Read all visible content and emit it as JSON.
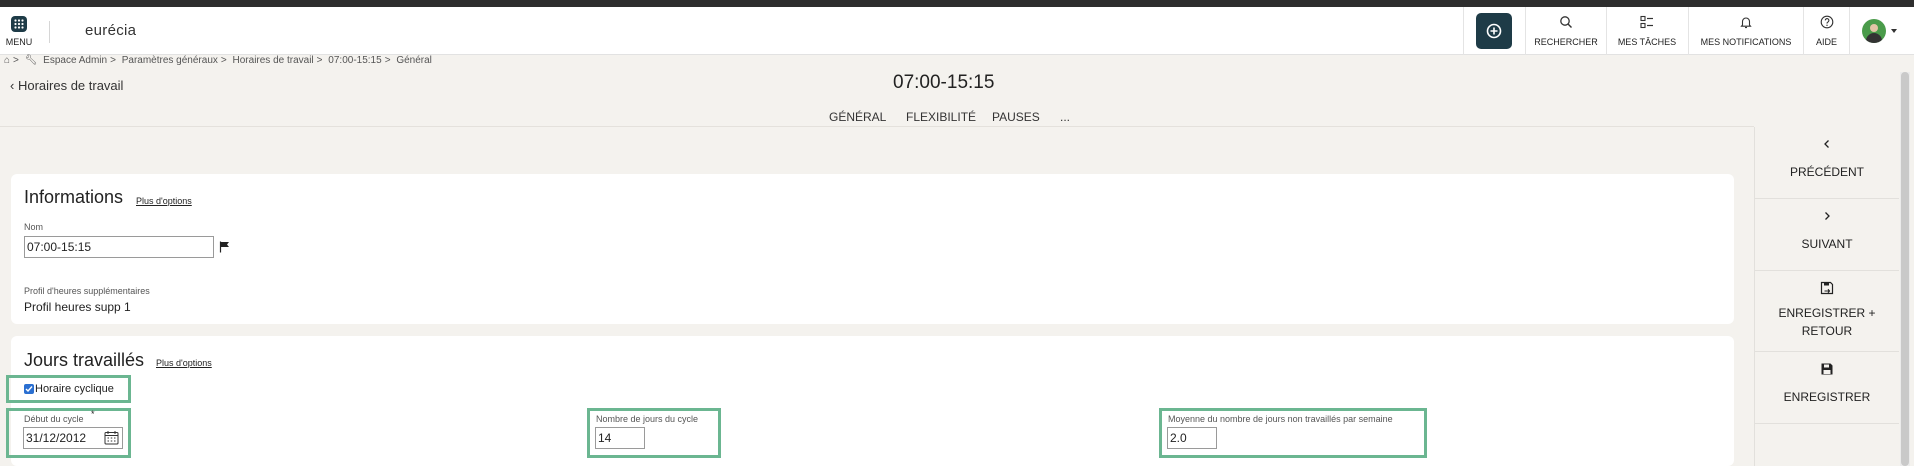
{
  "header": {
    "menu_label": "MENU",
    "logo_text": "eurécia",
    "items": [
      {
        "label": "RECHERCHER",
        "icon": "search-icon"
      },
      {
        "label": "MES TÂCHES",
        "icon": "tasks-icon"
      },
      {
        "label": "MES NOTIFICATIONS",
        "icon": "bell-icon"
      },
      {
        "label": "AIDE",
        "icon": "help-icon"
      }
    ]
  },
  "breadcrumb": {
    "items": [
      "Espace Admin",
      "Paramètres généraux",
      "Horaires de travail",
      "07:00-15:15",
      "Général"
    ],
    "separator": ">"
  },
  "page": {
    "back_label": "Horaires de travail",
    "title": "07:00-15:15",
    "tabs": [
      "GÉNÉRAL",
      "FLEXIBILITÉ",
      "PAUSES",
      "..."
    ]
  },
  "informations": {
    "title": "Informations",
    "plus_options": "Plus d'options",
    "nom_label": "Nom",
    "nom_value": "07:00-15:15",
    "profil_label": "Profil d'heures supplémentaires",
    "profil_value": "Profil heures supp 1"
  },
  "jours": {
    "title": "Jours travaillés",
    "plus_options": "Plus d'options",
    "cyclique_label": "Horaire cyclique",
    "cyclique_checked": true,
    "debut_label": "Début du cycle",
    "debut_required": "*",
    "debut_value": "31/12/2012",
    "nb_jours_label": "Nombre de jours du cycle",
    "nb_jours_value": "14",
    "moyenne_label": "Moyenne du nombre de jours non travaillés par semaine",
    "moyenne_value": "2.0"
  },
  "sidebar": {
    "buttons": [
      {
        "label": "PRÉCÉDENT",
        "icon": "chevron-left-icon"
      },
      {
        "label": "SUIVANT",
        "icon": "chevron-right-icon"
      },
      {
        "label_line1": "ENREGISTRER +",
        "label_line2": "RETOUR",
        "icon": "save-return-icon"
      },
      {
        "label": "ENREGISTRER",
        "icon": "save-icon"
      }
    ]
  },
  "colors": {
    "accent_dark": "#1e3b47",
    "highlight_green": "#6bb691",
    "checkbox_blue": "#2a6fd1"
  }
}
